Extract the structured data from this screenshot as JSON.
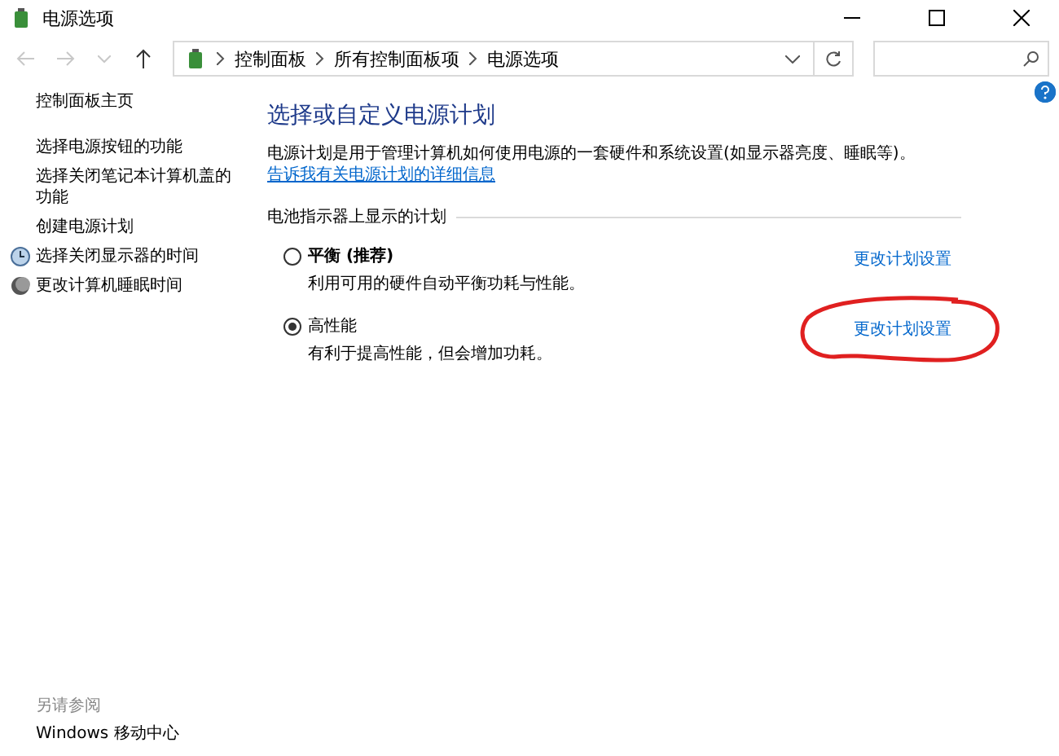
{
  "window": {
    "title": "电源选项"
  },
  "address_bar": {
    "breadcrumbs": [
      "控制面板",
      "所有控制面板项",
      "电源选项"
    ]
  },
  "sidebar": {
    "items": [
      {
        "label": "控制面板主页"
      },
      {
        "label": "选择电源按钮的功能"
      },
      {
        "label": "选择关闭笔记本计算机盖的功能"
      },
      {
        "label": "创建电源计划"
      },
      {
        "label": "选择关闭显示器的时间"
      },
      {
        "label": "更改计算机睡眠时间"
      }
    ],
    "see_also": {
      "heading": "另请参阅",
      "items": [
        "Windows 移动中心"
      ]
    }
  },
  "main": {
    "heading": "选择或自定义电源计划",
    "description": "电源计划是用于管理计算机如何使用电源的一套硬件和系统设置(如显示器亮度、睡眠等)。",
    "description_link": "告诉我有关电源计划的详细信息",
    "group_label": "电池指示器上显示的计划",
    "plans": [
      {
        "name": "平衡 (推荐)",
        "bold": true,
        "description": "利用可用的硬件自动平衡功耗与性能。",
        "link": "更改计划设置",
        "selected": false
      },
      {
        "name": "高性能",
        "bold": false,
        "description": "有利于提高性能，但会增加功耗。",
        "link": "更改计划设置",
        "selected": true,
        "circled": true
      }
    ]
  }
}
